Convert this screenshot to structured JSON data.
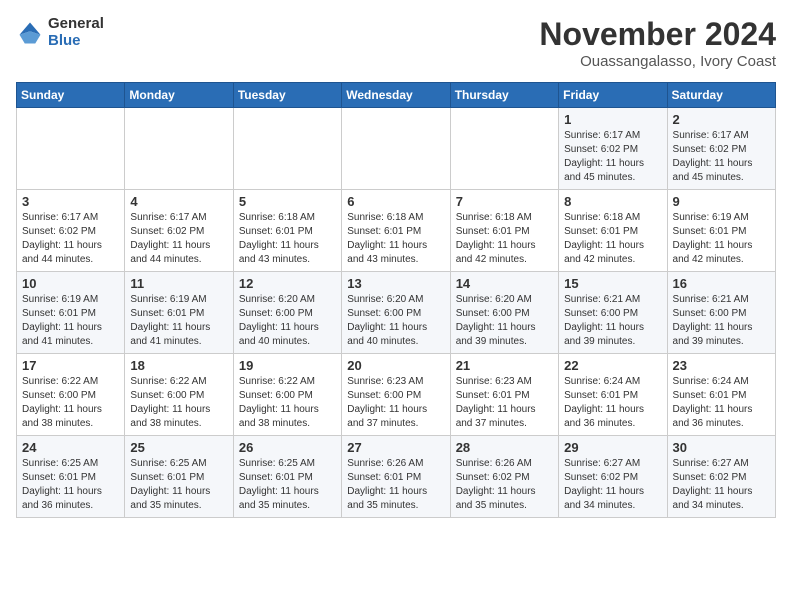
{
  "header": {
    "logo_general": "General",
    "logo_blue": "Blue",
    "title": "November 2024",
    "location": "Ouassangalasso, Ivory Coast"
  },
  "weekdays": [
    "Sunday",
    "Monday",
    "Tuesday",
    "Wednesday",
    "Thursday",
    "Friday",
    "Saturday"
  ],
  "weeks": [
    [
      {
        "day": "",
        "info": ""
      },
      {
        "day": "",
        "info": ""
      },
      {
        "day": "",
        "info": ""
      },
      {
        "day": "",
        "info": ""
      },
      {
        "day": "",
        "info": ""
      },
      {
        "day": "1",
        "info": "Sunrise: 6:17 AM\nSunset: 6:02 PM\nDaylight: 11 hours\nand 45 minutes."
      },
      {
        "day": "2",
        "info": "Sunrise: 6:17 AM\nSunset: 6:02 PM\nDaylight: 11 hours\nand 45 minutes."
      }
    ],
    [
      {
        "day": "3",
        "info": "Sunrise: 6:17 AM\nSunset: 6:02 PM\nDaylight: 11 hours\nand 44 minutes."
      },
      {
        "day": "4",
        "info": "Sunrise: 6:17 AM\nSunset: 6:02 PM\nDaylight: 11 hours\nand 44 minutes."
      },
      {
        "day": "5",
        "info": "Sunrise: 6:18 AM\nSunset: 6:01 PM\nDaylight: 11 hours\nand 43 minutes."
      },
      {
        "day": "6",
        "info": "Sunrise: 6:18 AM\nSunset: 6:01 PM\nDaylight: 11 hours\nand 43 minutes."
      },
      {
        "day": "7",
        "info": "Sunrise: 6:18 AM\nSunset: 6:01 PM\nDaylight: 11 hours\nand 42 minutes."
      },
      {
        "day": "8",
        "info": "Sunrise: 6:18 AM\nSunset: 6:01 PM\nDaylight: 11 hours\nand 42 minutes."
      },
      {
        "day": "9",
        "info": "Sunrise: 6:19 AM\nSunset: 6:01 PM\nDaylight: 11 hours\nand 42 minutes."
      }
    ],
    [
      {
        "day": "10",
        "info": "Sunrise: 6:19 AM\nSunset: 6:01 PM\nDaylight: 11 hours\nand 41 minutes."
      },
      {
        "day": "11",
        "info": "Sunrise: 6:19 AM\nSunset: 6:01 PM\nDaylight: 11 hours\nand 41 minutes."
      },
      {
        "day": "12",
        "info": "Sunrise: 6:20 AM\nSunset: 6:00 PM\nDaylight: 11 hours\nand 40 minutes."
      },
      {
        "day": "13",
        "info": "Sunrise: 6:20 AM\nSunset: 6:00 PM\nDaylight: 11 hours\nand 40 minutes."
      },
      {
        "day": "14",
        "info": "Sunrise: 6:20 AM\nSunset: 6:00 PM\nDaylight: 11 hours\nand 39 minutes."
      },
      {
        "day": "15",
        "info": "Sunrise: 6:21 AM\nSunset: 6:00 PM\nDaylight: 11 hours\nand 39 minutes."
      },
      {
        "day": "16",
        "info": "Sunrise: 6:21 AM\nSunset: 6:00 PM\nDaylight: 11 hours\nand 39 minutes."
      }
    ],
    [
      {
        "day": "17",
        "info": "Sunrise: 6:22 AM\nSunset: 6:00 PM\nDaylight: 11 hours\nand 38 minutes."
      },
      {
        "day": "18",
        "info": "Sunrise: 6:22 AM\nSunset: 6:00 PM\nDaylight: 11 hours\nand 38 minutes."
      },
      {
        "day": "19",
        "info": "Sunrise: 6:22 AM\nSunset: 6:00 PM\nDaylight: 11 hours\nand 38 minutes."
      },
      {
        "day": "20",
        "info": "Sunrise: 6:23 AM\nSunset: 6:00 PM\nDaylight: 11 hours\nand 37 minutes."
      },
      {
        "day": "21",
        "info": "Sunrise: 6:23 AM\nSunset: 6:01 PM\nDaylight: 11 hours\nand 37 minutes."
      },
      {
        "day": "22",
        "info": "Sunrise: 6:24 AM\nSunset: 6:01 PM\nDaylight: 11 hours\nand 36 minutes."
      },
      {
        "day": "23",
        "info": "Sunrise: 6:24 AM\nSunset: 6:01 PM\nDaylight: 11 hours\nand 36 minutes."
      }
    ],
    [
      {
        "day": "24",
        "info": "Sunrise: 6:25 AM\nSunset: 6:01 PM\nDaylight: 11 hours\nand 36 minutes."
      },
      {
        "day": "25",
        "info": "Sunrise: 6:25 AM\nSunset: 6:01 PM\nDaylight: 11 hours\nand 35 minutes."
      },
      {
        "day": "26",
        "info": "Sunrise: 6:25 AM\nSunset: 6:01 PM\nDaylight: 11 hours\nand 35 minutes."
      },
      {
        "day": "27",
        "info": "Sunrise: 6:26 AM\nSunset: 6:01 PM\nDaylight: 11 hours\nand 35 minutes."
      },
      {
        "day": "28",
        "info": "Sunrise: 6:26 AM\nSunset: 6:02 PM\nDaylight: 11 hours\nand 35 minutes."
      },
      {
        "day": "29",
        "info": "Sunrise: 6:27 AM\nSunset: 6:02 PM\nDaylight: 11 hours\nand 34 minutes."
      },
      {
        "day": "30",
        "info": "Sunrise: 6:27 AM\nSunset: 6:02 PM\nDaylight: 11 hours\nand 34 minutes."
      }
    ]
  ]
}
